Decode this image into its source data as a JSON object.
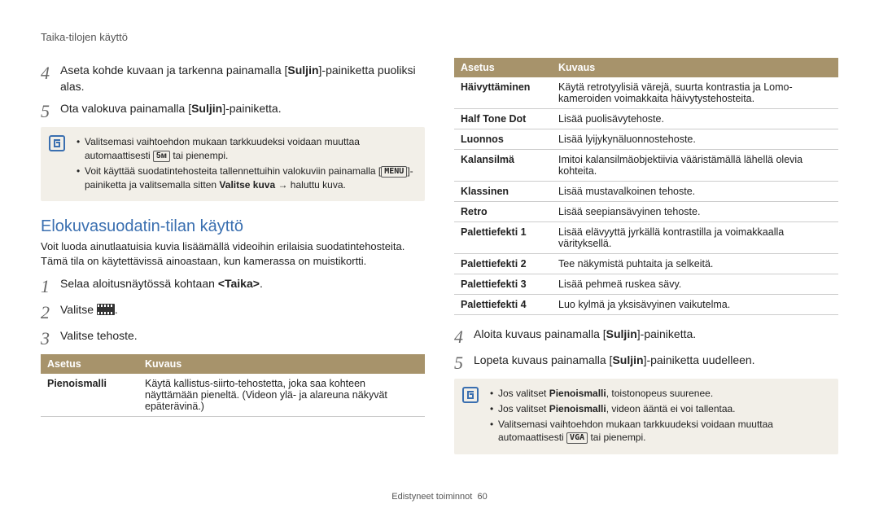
{
  "breadcrumb": "Taika-tilojen käyttö",
  "left": {
    "step4_pre": "Aseta kohde kuvaan ja tarkenna painamalla [",
    "step4_b": "Suljin",
    "step4_post": "]-painiketta puoliksi alas.",
    "step5_pre": "Ota valokuva painamalla [",
    "step5_b": "Suljin",
    "step5_post": "]-painiketta.",
    "note1_a": "Valitsemasi vaihtoehdon mukaan tarkkuudeksi voidaan muuttaa automaattisesti ",
    "note1_a2": " tai pienempi.",
    "note1_b_pre": "Voit käyttää suodatintehosteita tallennettuihin valokuviin painamalla [",
    "note1_b_mid": "]-painiketta ja valitsemalla sitten ",
    "note1_b_bold": "Valitse kuva",
    "note1_b_post": " → haluttu kuva.",
    "section_title": "Elokuvasuodatin-tilan käyttö",
    "lead": "Voit luoda ainutlaatuisia kuvia lisäämällä videoihin erilaisia suodatintehosteita. Tämä tila on käytettävissä ainoastaan, kun kamerassa on muistikortti.",
    "s1_pre": "Selaa aloitusnäytössä kohtaan ",
    "s1_b": "<Taika>",
    "s1_post": ".",
    "s2": "Valitse ",
    "s2_post": ".",
    "s3": "Valitse tehoste.",
    "table_h1": "Asetus",
    "table_h2": "Kuvaus",
    "row1_k": "Pienoismalli",
    "row1_v": "Käytä kallistus-siirto-tehostetta, joka saa kohteen näyttämään pieneltä. (Videon ylä- ja alareuna näkyvät epäterävinä.)"
  },
  "right": {
    "table_h1": "Asetus",
    "table_h2": "Kuvaus",
    "rows": [
      {
        "k": "Häivyttäminen",
        "v": "Käytä retrotyylisiä värejä, suurta kontrastia ja Lomo-kameroiden voimakkaita häivytystehosteita."
      },
      {
        "k": "Half Tone Dot",
        "v": "Lisää puolisävytehoste."
      },
      {
        "k": "Luonnos",
        "v": "Lisää lyijykynäluonnostehoste."
      },
      {
        "k": "Kalansilmä",
        "v": "Imitoi kalansilmäobjektiivia vääristämällä lähellä olevia kohteita."
      },
      {
        "k": "Klassinen",
        "v": "Lisää mustavalkoinen tehoste."
      },
      {
        "k": "Retro",
        "v": "Lisää seepiansävyinen tehoste."
      },
      {
        "k": "Palettiefekti 1",
        "v": "Lisää elävyyttä jyrkällä kontrastilla ja voimakkaalla värityksellä."
      },
      {
        "k": "Palettiefekti 2",
        "v": "Tee näkymistä puhtaita ja selkeitä."
      },
      {
        "k": "Palettiefekti 3",
        "v": "Lisää pehmeä ruskea sävy."
      },
      {
        "k": "Palettiefekti 4",
        "v": "Luo kylmä ja yksisävyinen vaikutelma."
      }
    ],
    "step4_pre": "Aloita kuvaus painamalla [",
    "step4_b": "Suljin",
    "step4_post": "]-painiketta.",
    "step5_pre": "Lopeta kuvaus painamalla [",
    "step5_b": "Suljin",
    "step5_post": "]-painiketta uudelleen.",
    "note_li1_pre": "Jos valitset ",
    "note_li1_b": "Pienoismalli",
    "note_li1_post": ", toistonopeus suurenee.",
    "note_li2_pre": "Jos valitset ",
    "note_li2_b": "Pienoismalli",
    "note_li2_post": ", videon ääntä ei voi tallentaa.",
    "note_li3_pre": "Valitsemasi vaihtoehdon mukaan tarkkuudeksi voidaan muuttaa automaattisesti ",
    "note_li3_chip": "VGA",
    "note_li3_post": " tai pienempi."
  },
  "footer_label": "Edistyneet toiminnot",
  "footer_page": "60"
}
